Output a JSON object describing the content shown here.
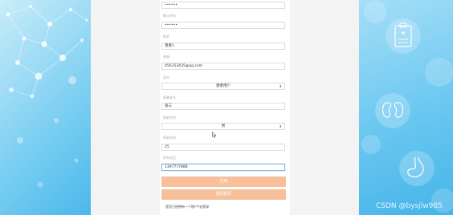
{
  "form": {
    "fields": [
      {
        "label": "",
        "value": "••••••",
        "type": "password"
      },
      {
        "label": "确认密码",
        "value": "••••••",
        "type": "password"
      },
      {
        "label": "昵称",
        "value": "患者1",
        "type": "text"
      },
      {
        "label": "邮箱",
        "value": "456153435@qq.com",
        "type": "text"
      },
      {
        "label": "身份",
        "value": "患者用户",
        "type": "select"
      },
      {
        "label": "患者姓名",
        "value": "张三",
        "type": "text"
      },
      {
        "label": "患者性别",
        "value": "男",
        "type": "select"
      },
      {
        "label": "患者年龄",
        "value": "25",
        "type": "text"
      },
      {
        "label": "联系电话",
        "value": "1397777888",
        "type": "text"
      }
    ],
    "submit_label": "注册",
    "back_label": "返回首页",
    "footer_text": "是否已经拥有一个账户?去登录",
    "select_arrow": "⬍"
  },
  "watermark": "CSDN @bysjlw985",
  "colors": {
    "button": "#f7c09a",
    "active_border": "#88b8e8",
    "left_panel": "#7fd0f2",
    "right_panel": "#6fc9f1"
  },
  "icons": {
    "left_panel": "molecule-network",
    "right_panel": [
      "medical-clipboard-icon",
      "kidney-icon",
      "stomach-icon"
    ]
  }
}
